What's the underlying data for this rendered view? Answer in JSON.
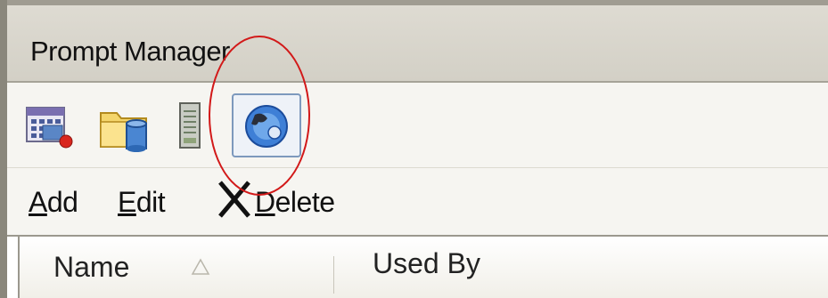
{
  "window": {
    "title": "Prompt Manager"
  },
  "toolbar_icons": [
    {
      "name": "calendar-icon"
    },
    {
      "name": "folder-database-icon"
    },
    {
      "name": "server-icon"
    },
    {
      "name": "globe-icon",
      "selected": true
    }
  ],
  "actions": {
    "add": {
      "first": "A",
      "rest": "dd"
    },
    "edit": {
      "first": "E",
      "rest": "dit"
    },
    "delete": {
      "first": "D",
      "rest": "elete"
    }
  },
  "table": {
    "columns": [
      {
        "label": "Name",
        "sort": "ascending"
      },
      {
        "label": "Used By"
      }
    ]
  },
  "colors": {
    "annotation": "#d21919",
    "selection_border": "#7d99bd"
  }
}
